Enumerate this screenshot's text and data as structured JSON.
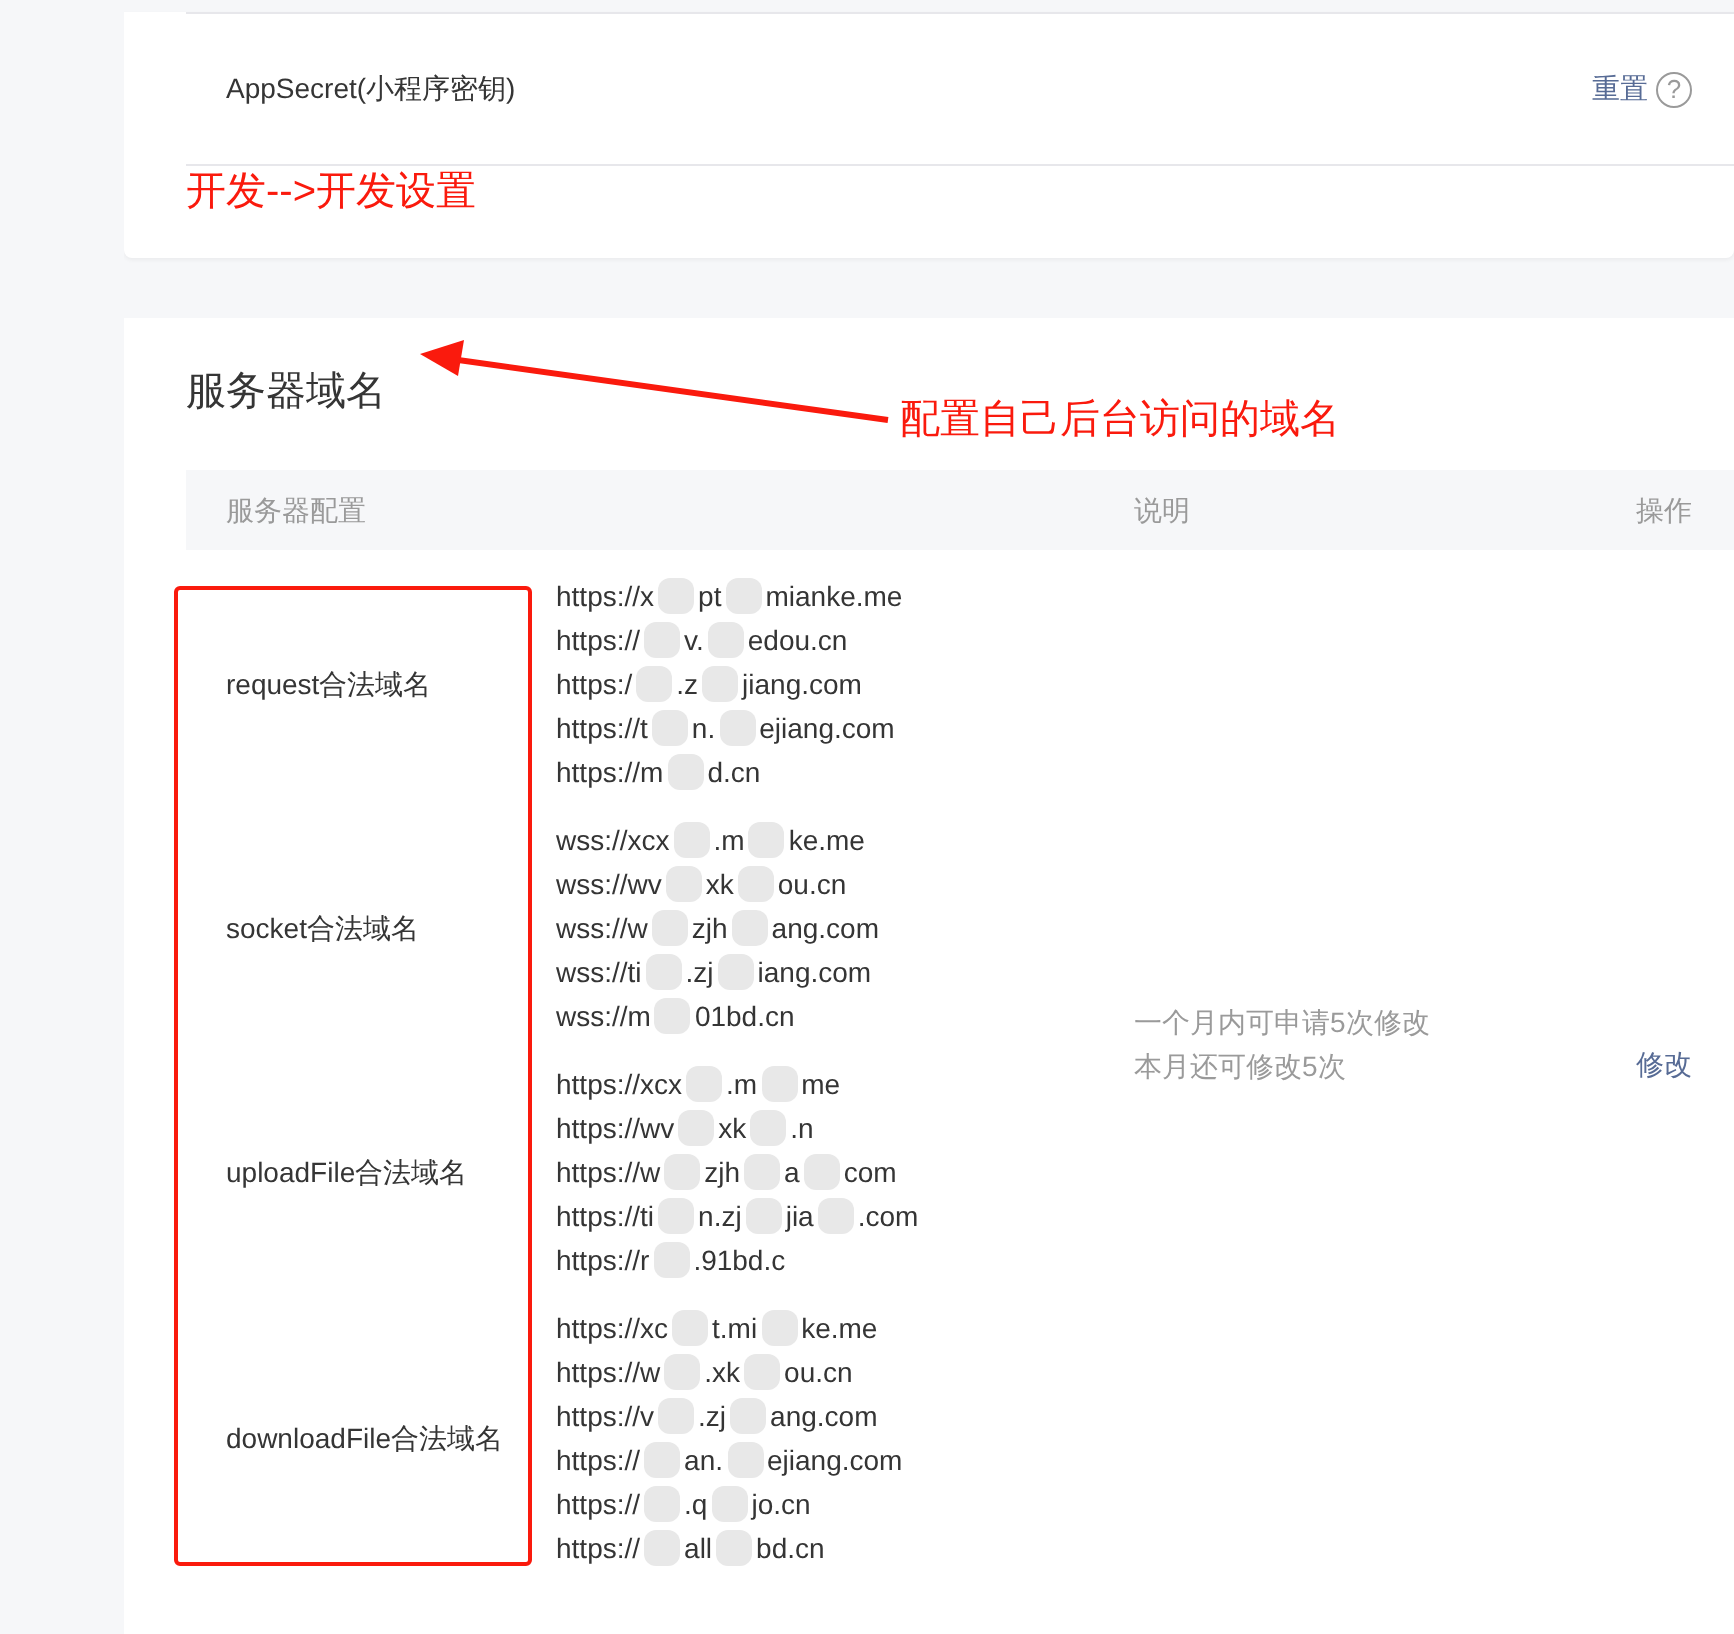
{
  "top_card": {
    "rows": [
      {
        "label": "AppSecret(小程序密钥)",
        "action": "重置",
        "help": "?"
      }
    ],
    "annotation": "开发-->开发设置"
  },
  "section": {
    "title": "服务器域名",
    "annotation": "配置自己后台访问的域名",
    "table": {
      "columns": [
        "服务器配置",
        "说明",
        "操作"
      ],
      "groups": [
        {
          "label": "request合法域名",
          "urls": [
            [
              "https://x",
              "pt",
              "mianke.me"
            ],
            [
              "https://",
              "v.",
              "edou.cn"
            ],
            [
              "https:/",
              ".z",
              "jiang.com"
            ],
            [
              "https://t",
              "n.",
              "ejiang.com"
            ],
            [
              "https://m",
              "d.cn"
            ]
          ]
        },
        {
          "label": "socket合法域名",
          "urls": [
            [
              "wss://xcx",
              ".m",
              "ke.me"
            ],
            [
              "wss://wv",
              "xk",
              "ou.cn"
            ],
            [
              "wss://w",
              "zjh",
              "ang.com"
            ],
            [
              "wss://ti",
              ".zj",
              "iang.com"
            ],
            [
              "wss://m",
              "01bd.cn"
            ]
          ]
        },
        {
          "label": "uploadFile合法域名",
          "urls": [
            [
              "https://xcx",
              ".m",
              "me"
            ],
            [
              "https://wv",
              "xk",
              ".n"
            ],
            [
              "https://w",
              "zjh",
              "a",
              "com"
            ],
            [
              "https://ti",
              "n.zj",
              "jia",
              ".com"
            ],
            [
              "https://r",
              ".91bd.c"
            ]
          ]
        },
        {
          "label": "downloadFile合法域名",
          "urls": [
            [
              "https://xc",
              "t.mi",
              "ke.me"
            ],
            [
              "https://w",
              ".xk",
              "ou.cn"
            ],
            [
              "https://v",
              ".zj",
              "ang.com"
            ],
            [
              "https://",
              "an.",
              "ejiang.com"
            ],
            [
              "https://",
              ".q",
              "jo.cn"
            ],
            [
              "https://",
              "all",
              "bd.cn"
            ]
          ]
        }
      ],
      "note": [
        "一个月内可申请5次修改",
        "本月还可修改5次"
      ],
      "action": "修改"
    }
  }
}
